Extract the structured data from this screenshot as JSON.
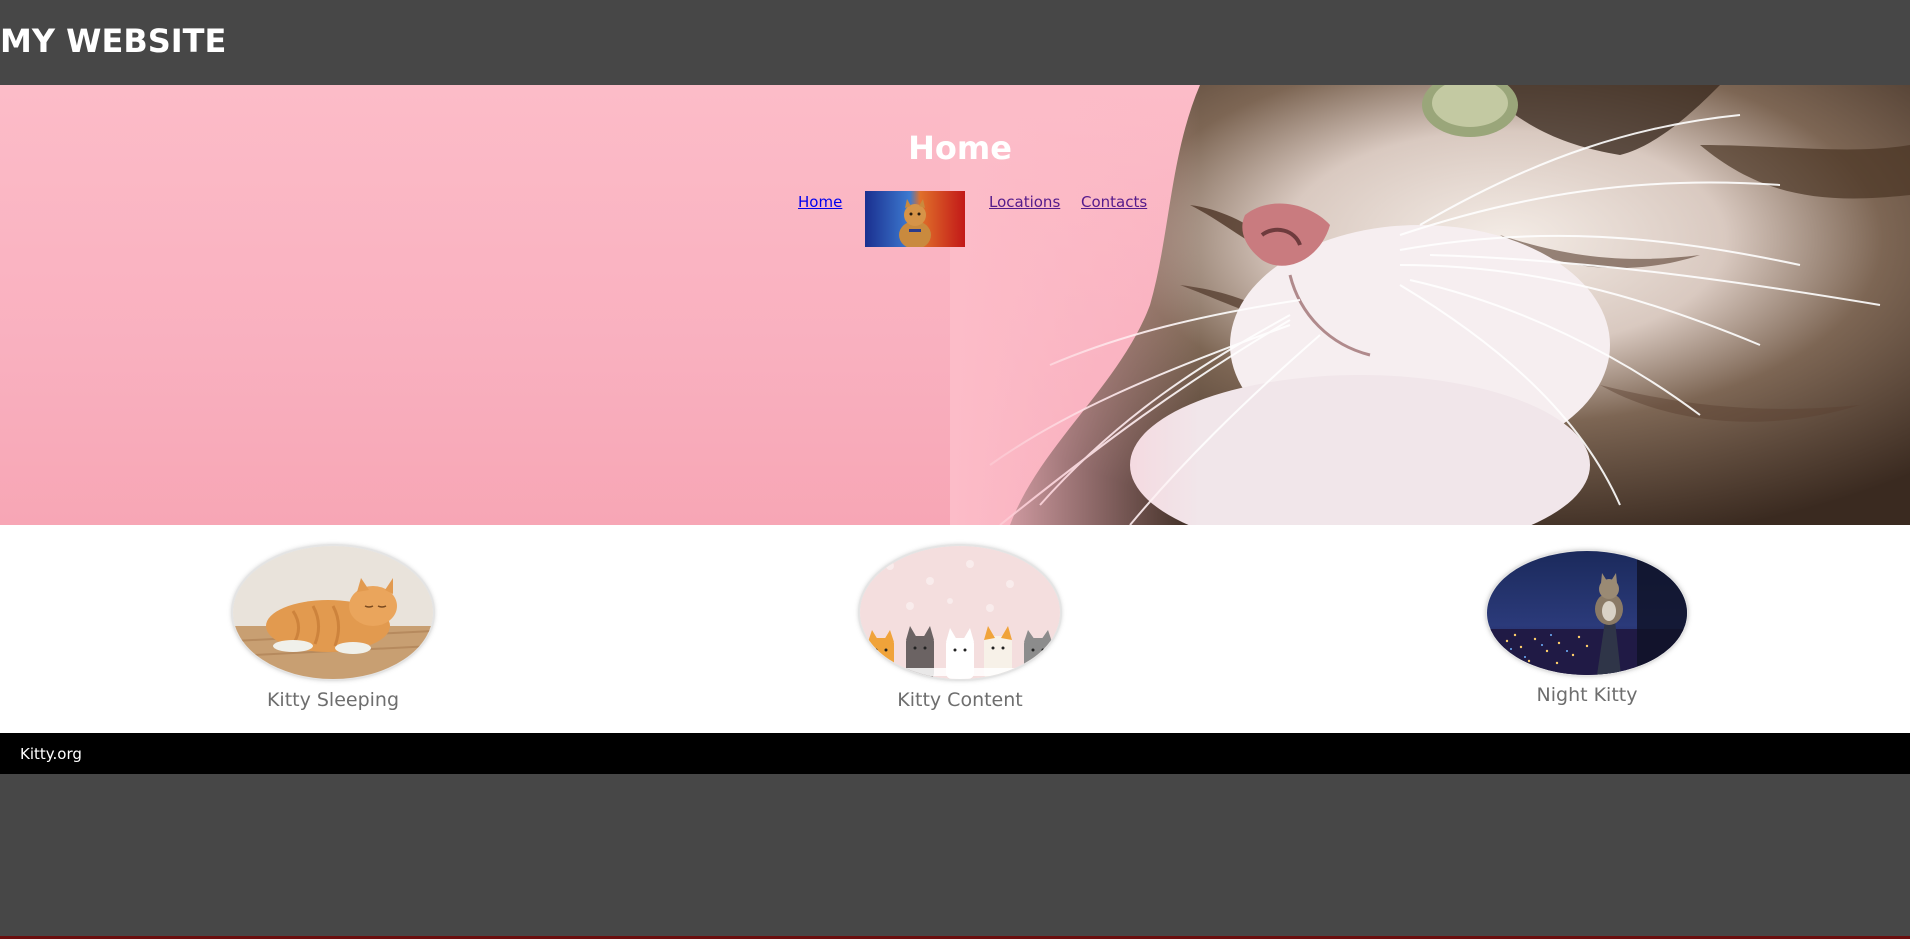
{
  "header": {
    "site_title": "MY WEBSITE"
  },
  "hero": {
    "title": "Home",
    "nav": {
      "home": "Home",
      "locations": "Locations",
      "contacts": "Contacts"
    }
  },
  "gallery": {
    "items": [
      {
        "caption": "Kitty Sleeping"
      },
      {
        "caption": "Kitty Content"
      },
      {
        "caption": "Night Kitty"
      }
    ]
  },
  "footer": {
    "text": "Kitty.org"
  }
}
